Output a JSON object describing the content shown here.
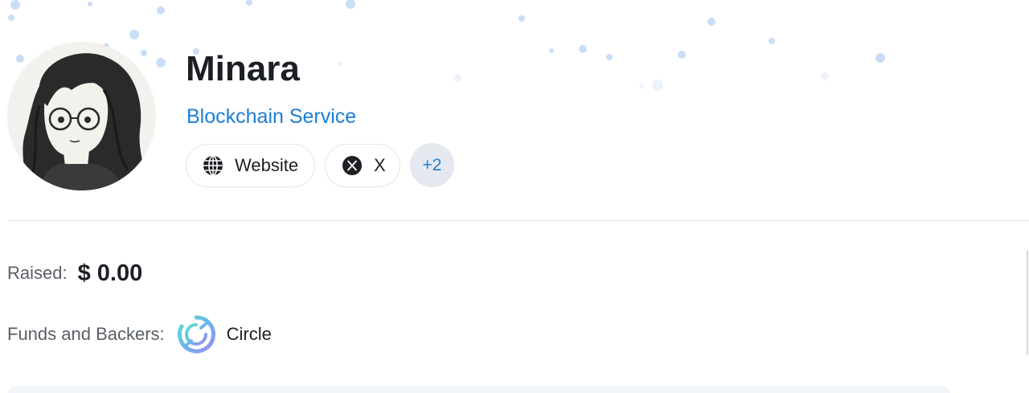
{
  "project": {
    "name": "Minara",
    "category": "Blockchain Service"
  },
  "links": {
    "website_label": "Website",
    "x_label": "X",
    "more_label": "+2"
  },
  "details": {
    "raised_label": "Raised:",
    "raised_value": "$ 0.00",
    "funds_label": "Funds and Backers:",
    "backers": [
      "Circle"
    ]
  },
  "colors": {
    "category_link": "#1a7fd6",
    "more_badge_bg": "#e5e8ef",
    "divider": "#e3e5e8"
  },
  "icons": {
    "website": "globe-icon",
    "x": "x-logo-icon",
    "backer": "circle-logo-icon"
  }
}
